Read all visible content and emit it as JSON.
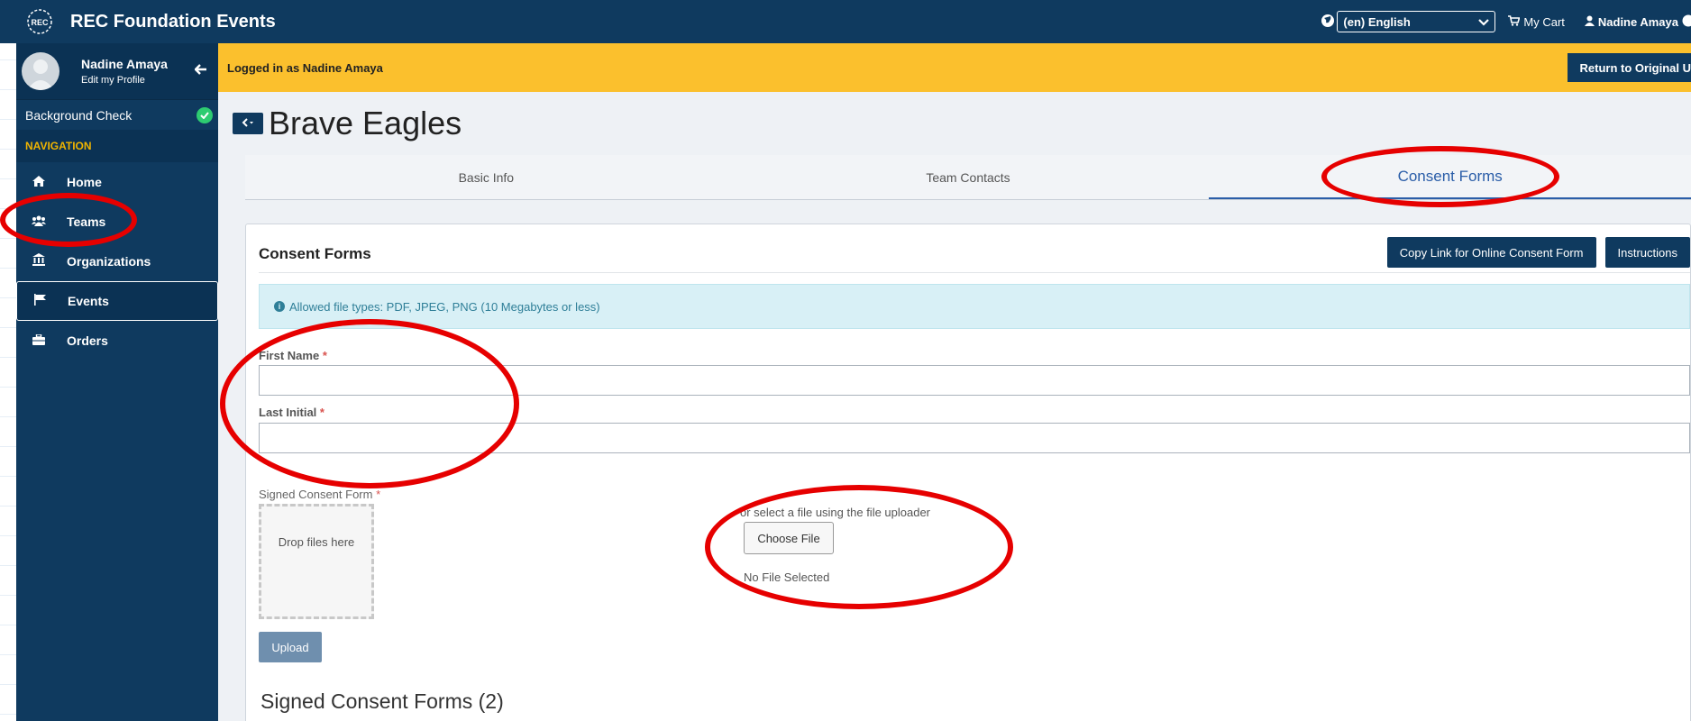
{
  "topbar": {
    "logo_text": "REC",
    "app_title": "REC Foundation Events",
    "language": "(en) English",
    "cart_label": "My Cart",
    "user_name": "Nadine Amaya"
  },
  "sidebar": {
    "profile": {
      "name": "Nadine Amaya",
      "edit_label": "Edit my Profile"
    },
    "background_check_label": "Background Check",
    "nav_header": "NAVIGATION",
    "items": [
      {
        "label": "Home",
        "icon": "home-icon"
      },
      {
        "label": "Teams",
        "icon": "users-icon"
      },
      {
        "label": "Organizations",
        "icon": "institution-icon"
      },
      {
        "label": "Events",
        "icon": "flag-icon"
      },
      {
        "label": "Orders",
        "icon": "briefcase-icon"
      }
    ]
  },
  "banner": {
    "logged_in_text": "Logged in as Nadine Amaya",
    "return_button": "Return to Original U"
  },
  "page": {
    "team_name": "Brave Eagles",
    "tabs": [
      {
        "label": "Basic Info"
      },
      {
        "label": "Team Contacts"
      },
      {
        "label": "Consent Forms"
      }
    ]
  },
  "card": {
    "title": "Consent Forms",
    "copy_link_button": "Copy Link for Online Consent Form",
    "instructions_button": "Instructions",
    "info_text": "Allowed file types: PDF, JPEG, PNG (10 Megabytes or less)",
    "first_name_label": "First Name",
    "last_initial_label": "Last Initial",
    "required_marker": "*",
    "signed_form_label": "Signed Consent Form",
    "dropzone_text": "Drop files here",
    "uploader_note": "or select a file using the file uploader",
    "choose_file_button": "Choose File",
    "no_file_text": "No File Selected",
    "upload_button": "Upload",
    "signed_forms_heading": "Signed Consent Forms (2)"
  },
  "colors": {
    "primary": "#0f3a5f",
    "banner": "#fbc02d",
    "accent": "#2a5da8",
    "annotation": "#e60000"
  }
}
